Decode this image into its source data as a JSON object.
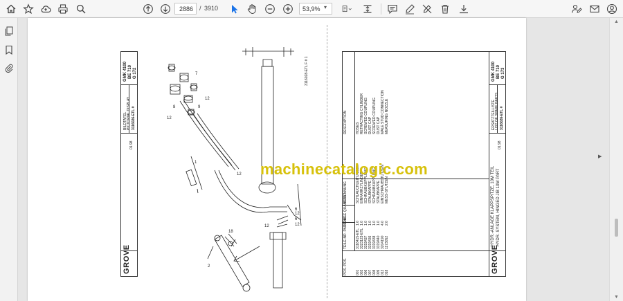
{
  "toolbar": {
    "page_current": "2886",
    "page_separator": "/",
    "page_total": "3910",
    "zoom": "53,9%"
  },
  "watermark": "machinecatalogic.com",
  "left_sheet": {
    "model": "GMK 4100",
    "edition": "BE 710",
    "sheet_no": "G 172",
    "part_no": "3116026-ETL #",
    "title_de": "BILDTAFEL",
    "title_en": "PICTORIAL DISPLAY",
    "page_ref": "01.98",
    "fig_label": "3116028-ETL F # 1",
    "brand": "GROVE",
    "callouts": [
      "1",
      "2",
      "3",
      "4",
      "5",
      "6",
      "7",
      "8",
      "9",
      "10",
      "11",
      "12",
      "13"
    ]
  },
  "right_sheet": {
    "model": "GMK 4100",
    "edition": "BE 710",
    "sheet_no": "G 173",
    "part_no": "3116026-ETL #",
    "title_de": "ERSATZTEILLISTE",
    "title_en": "LIST OF SPARE PARTS",
    "page_ref": "01.98",
    "assembly_de": "HYDR.-ANLAGE KLAPPSPITZE, 10M TEIL",
    "assembly_en": "HYDR. SYSTEM, HINGED JIB 10M PART",
    "brand": "GROVE",
    "headers": {
      "pos": "POS. POS.",
      "part_no": "TEILE-NR. PART NO.",
      "qty": "MENGE QUANTITY",
      "desc_de": "BENENNUNG",
      "desc_en": "DESCRIPTION"
    },
    "rows": [
      {
        "pos": "001",
        "part_no": "3116415-ETL",
        "qty": "1.0",
        "desc_de": "SCHLAUCHLEITUNGEN",
        "desc_en": "HOSES"
      },
      {
        "pos": "002",
        "part_no": "3323123-ETL",
        "qty": "1.0",
        "desc_de": "EINFAHRZYLINDER",
        "desc_en": "RETRACTING CYLINDER"
      },
      {
        "pos": "006",
        "part_no": "3319437",
        "qty": "1.0",
        "desc_de": "SCHRAUBKUPPLUNG",
        "desc_en": "SCREWED COUPLING"
      },
      {
        "pos": "007",
        "part_no": "3319436",
        "qty": "1.0",
        "desc_de": "STAUBKAPPE",
        "desc_en": "DUST CAP"
      },
      {
        "pos": "008",
        "part_no": "3319438",
        "qty": "1.0",
        "desc_de": "SCHRAUBKUPPLUNG",
        "desc_en": "SCREWED COUPLING"
      },
      {
        "pos": "009",
        "part_no": "3319440",
        "qty": "1.0",
        "desc_de": "STAUBKAPPE",
        "desc_en": "DUST CAP"
      },
      {
        "pos": "012",
        "part_no": "3204190",
        "qty": "4.0",
        "desc_de": "EINSCHRAUBSTUTZEN",
        "desc_en": "MALE STUD CONNECTION"
      },
      {
        "pos": "018",
        "part_no": "1173052",
        "qty": "2.0",
        "desc_de": "MESS-STUTZEN",
        "desc_en": "MEASURING NOZZLE"
      }
    ]
  },
  "colors": {
    "watermark": "#d7c10b",
    "active_tool": "#1a73e8",
    "toolbar_bg": "#f6f6f6",
    "canvas_bg": "#e6e6e6"
  }
}
